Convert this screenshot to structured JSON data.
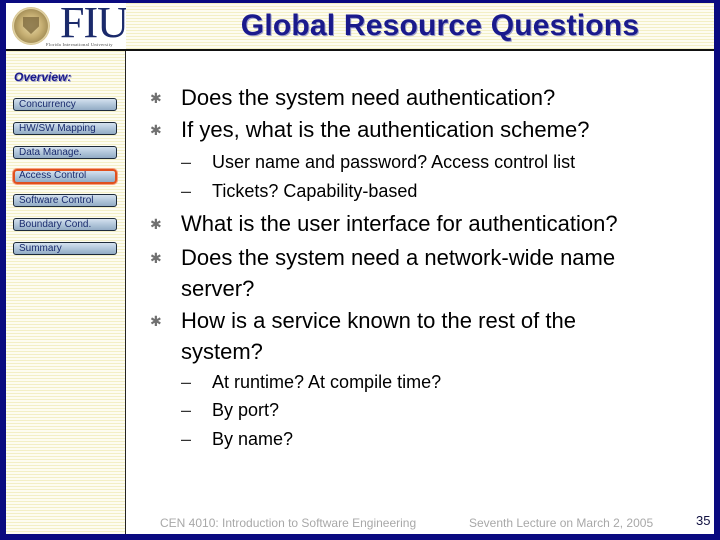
{
  "header": {
    "logo": {
      "text": "FIU",
      "subtitle": "Florida International University",
      "icon": "university-seal-icon"
    },
    "title": "Global Resource Questions"
  },
  "sidebar": {
    "heading": "Overview:",
    "items": [
      {
        "label": "Concurrency",
        "active": false
      },
      {
        "label": "HW/SW Mapping",
        "active": false
      },
      {
        "label": "Data Manage.",
        "active": false
      },
      {
        "label": "Access Control",
        "active": true
      },
      {
        "label": "Software Control",
        "active": false
      },
      {
        "label": "Boundary Cond.",
        "active": false
      },
      {
        "label": "Summary",
        "active": false
      }
    ]
  },
  "content": {
    "bullet_icon": "asterisk-bullet-icon",
    "sub_bullet_glyph": "–",
    "items": [
      {
        "level": 1,
        "text": "Does the system need authentication?"
      },
      {
        "level": 1,
        "text": "If yes, what is the authentication scheme?"
      },
      {
        "level": 2,
        "text": "User name and password? Access control list"
      },
      {
        "level": 2,
        "text": "Tickets? Capability-based"
      },
      {
        "level": 1,
        "text": "What is the user interface for authentication?"
      },
      {
        "level": 1,
        "text": "Does the system need a network-wide name"
      },
      {
        "level": 0,
        "text": "server?"
      },
      {
        "level": 1,
        "text": "How is a service known to the rest of the"
      },
      {
        "level": 0,
        "text": "system?"
      },
      {
        "level": 2,
        "text": "At runtime? At compile time?"
      },
      {
        "level": 2,
        "text": "By port?"
      },
      {
        "level": 2,
        "text": "By name?"
      }
    ]
  },
  "footer": {
    "course": "CEN 4010: Introduction to Software Engineering",
    "lecture": "Seventh Lecture on March 2, 2005",
    "page_number": "35"
  },
  "colors": {
    "frame": "#0a0a80",
    "title": "#1a1a8c",
    "active_outline": "#e0501e",
    "footer_text": "#a8a8a8"
  }
}
